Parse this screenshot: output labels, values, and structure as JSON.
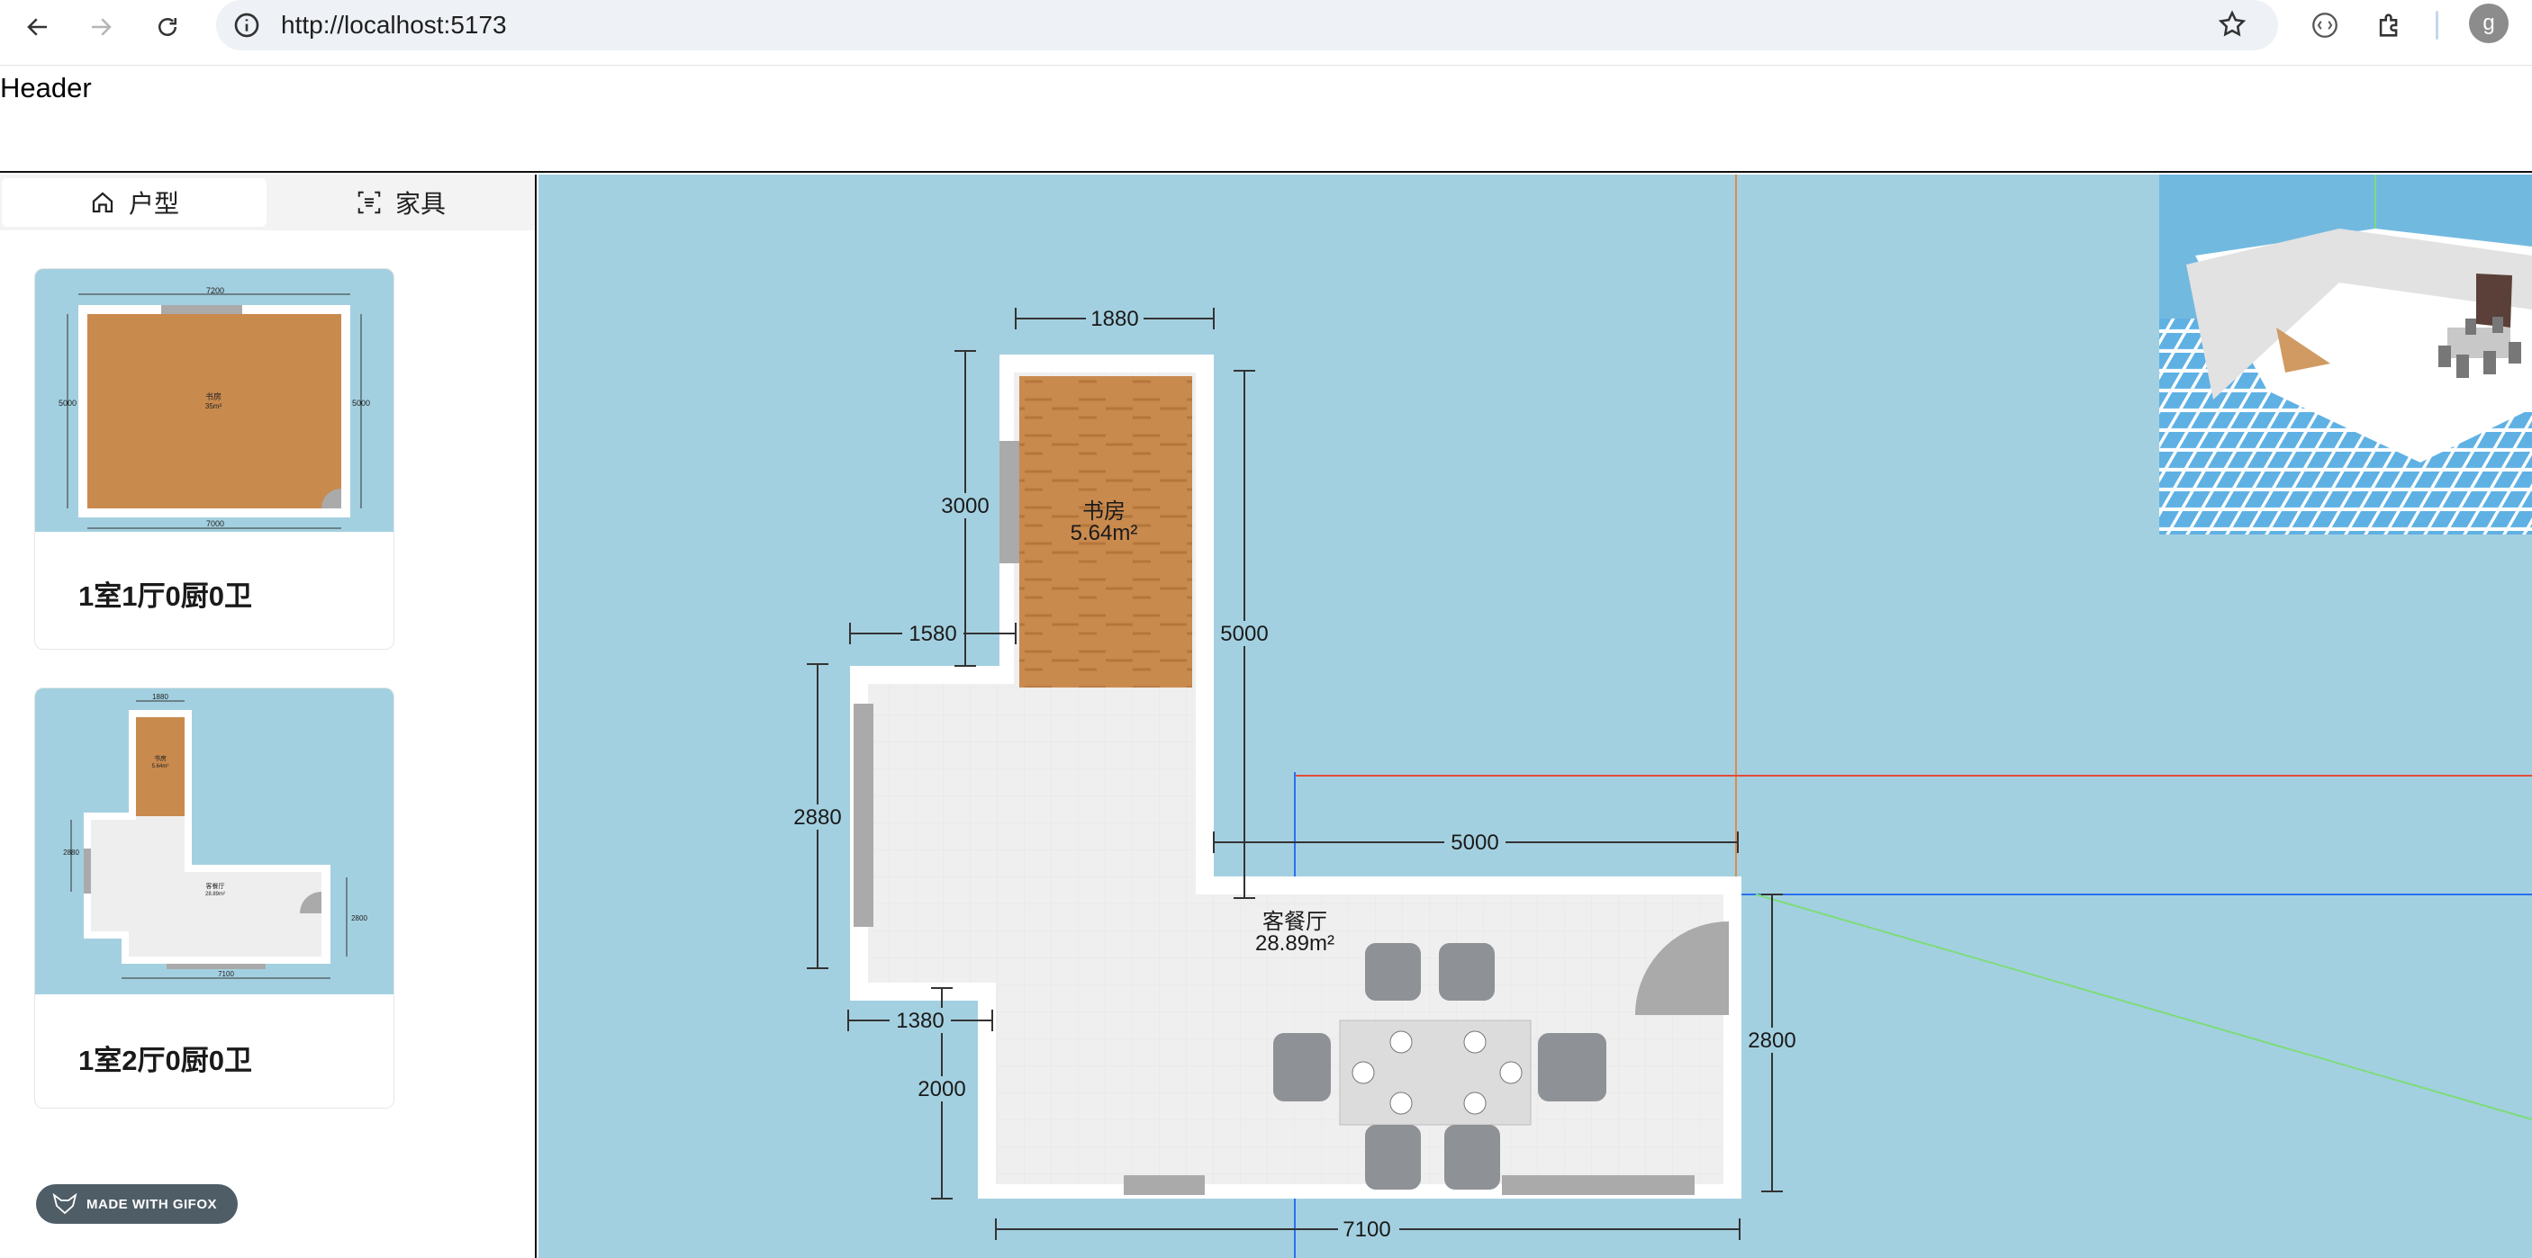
{
  "browser": {
    "url": "http://localhost:5173",
    "profile_initial": "g"
  },
  "page": {
    "header": "Header"
  },
  "sidebar": {
    "tabs": [
      {
        "label": "户型",
        "icon": "home-icon",
        "active": true
      },
      {
        "label": "家具",
        "icon": "scan-icon",
        "active": false
      }
    ],
    "cards": [
      {
        "title": "1室1厅0厨0卫",
        "thumb_dims": {
          "top": "7200",
          "bottom": "7000",
          "left": "5000",
          "right": "5000",
          "room": "书房",
          "area": "35m²"
        }
      },
      {
        "title": "1室2厅0厨0卫",
        "thumb_dims": {
          "top": "1880",
          "bottom": "7100",
          "left": "2880",
          "right": "2800",
          "room1": "书房",
          "area1": "5.64m²",
          "room2": "客餐厅",
          "area2": "28.89m²"
        }
      }
    ],
    "badge": "MADE WITH GIFOX"
  },
  "plan": {
    "rooms": [
      {
        "name": "书房",
        "area": "5.64m²"
      },
      {
        "name": "客餐厅",
        "area": "28.89m²"
      }
    ],
    "dimensions": {
      "d1880": "1880",
      "d3000": "3000",
      "d5000v": "5000",
      "d1580": "1580",
      "d2880": "2880",
      "d5000h": "5000",
      "d1380": "1380",
      "d2000": "2000",
      "d2800": "2800",
      "d7100": "7100"
    }
  },
  "colors": {
    "canvas_bg": "#a3d0e0",
    "wood": "#c98a4e",
    "tile": "#eeeeee",
    "axis_red": "#e34a3a",
    "axis_green": "#7ddc7a",
    "axis_blue": "#2b6ff0"
  }
}
